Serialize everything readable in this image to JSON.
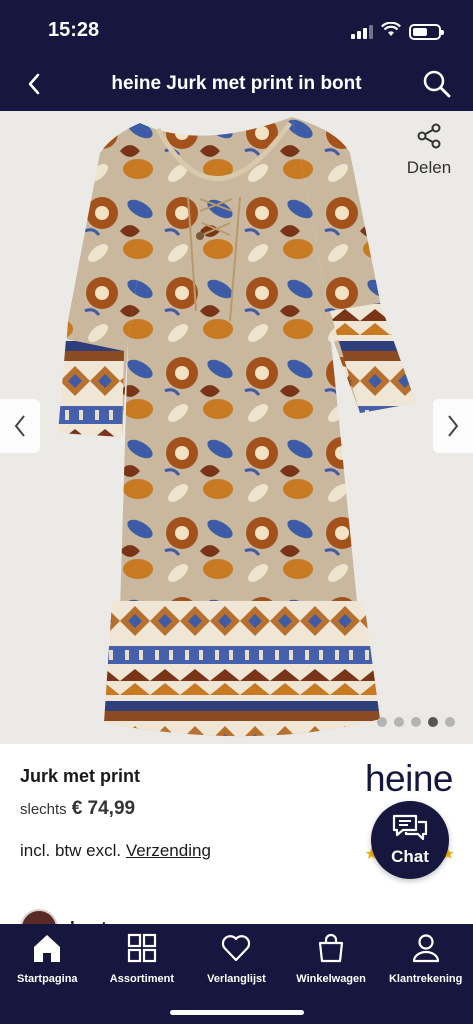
{
  "status_bar": {
    "time": "15:28"
  },
  "header": {
    "title": "heine Jurk met print in bont",
    "back_icon": "chevron-left-icon",
    "search_icon": "search-icon"
  },
  "gallery": {
    "share_label": "Delen",
    "image_count": 5,
    "active_index": 3
  },
  "product": {
    "name": "Jurk met print",
    "price_prefix": "slechts",
    "price": "€ 74,99",
    "tax_text": "incl. btw excl.",
    "shipping_link": "Verzending",
    "brand_logo": "heine",
    "brand_name_peek": "bont"
  },
  "chat": {
    "label": "Chat"
  },
  "tabs": [
    {
      "label": "Startpagina",
      "icon": "home-icon"
    },
    {
      "label": "Assortiment",
      "icon": "grid-icon"
    },
    {
      "label": "Verlanglijst",
      "icon": "heart-icon"
    },
    {
      "label": "Winkelwagen",
      "icon": "shopping-bag-icon"
    },
    {
      "label": "Klantrekening",
      "icon": "person-icon"
    }
  ],
  "colors": {
    "navy": "#16163e",
    "star": "#f3b20f"
  }
}
